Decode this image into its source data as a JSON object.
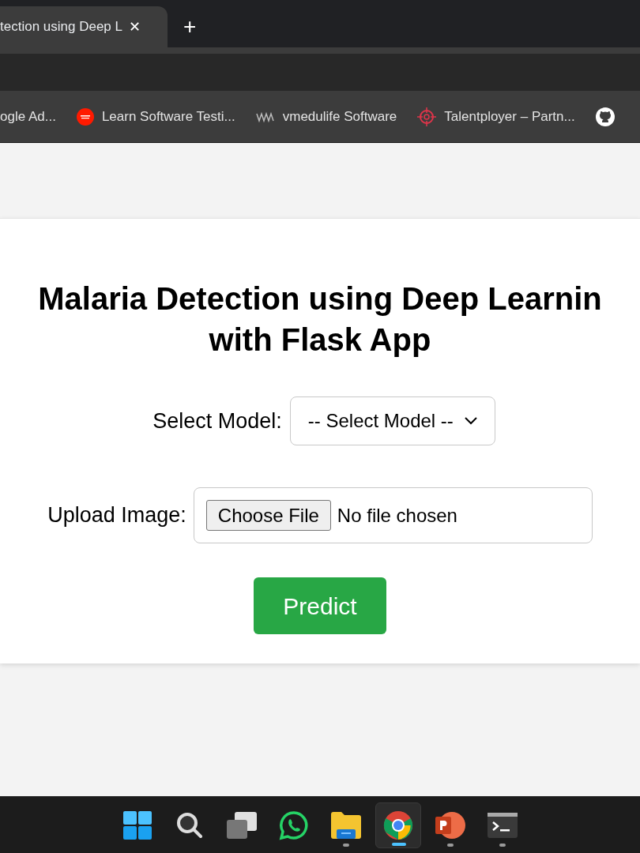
{
  "tab": {
    "title": "tection using Deep L",
    "close": "✕",
    "new_tab": "+"
  },
  "bookmarks": [
    {
      "kind": "none",
      "label": "ogle Ad..."
    },
    {
      "kind": "badge",
      "label": "Learn Software Testi..."
    },
    {
      "kind": "wave",
      "label": "vmedulife Software"
    },
    {
      "kind": "target",
      "label": "Talentployer – Partn..."
    },
    {
      "kind": "github"
    }
  ],
  "page": {
    "title_lines": [
      "Malaria Detection using Deep Learnin",
      "with Flask App"
    ],
    "model_label": "Select Model:",
    "model_value": "-- Select Model --",
    "upload_label": "Upload Image:",
    "file_button": "Choose File",
    "file_status": "No file chosen",
    "predict_button": "Predict"
  },
  "taskbar": [
    {
      "kind": "start",
      "running": false,
      "selected": false
    },
    {
      "kind": "search",
      "running": false,
      "selected": false
    },
    {
      "kind": "taskview",
      "running": false,
      "selected": false
    },
    {
      "kind": "whatsapp",
      "running": false,
      "selected": false
    },
    {
      "kind": "files",
      "running": true,
      "selected": false
    },
    {
      "kind": "chrome",
      "running": true,
      "selected": true
    },
    {
      "kind": "powerpoint",
      "running": true,
      "selected": false
    },
    {
      "kind": "terminal",
      "running": true,
      "selected": false
    }
  ]
}
